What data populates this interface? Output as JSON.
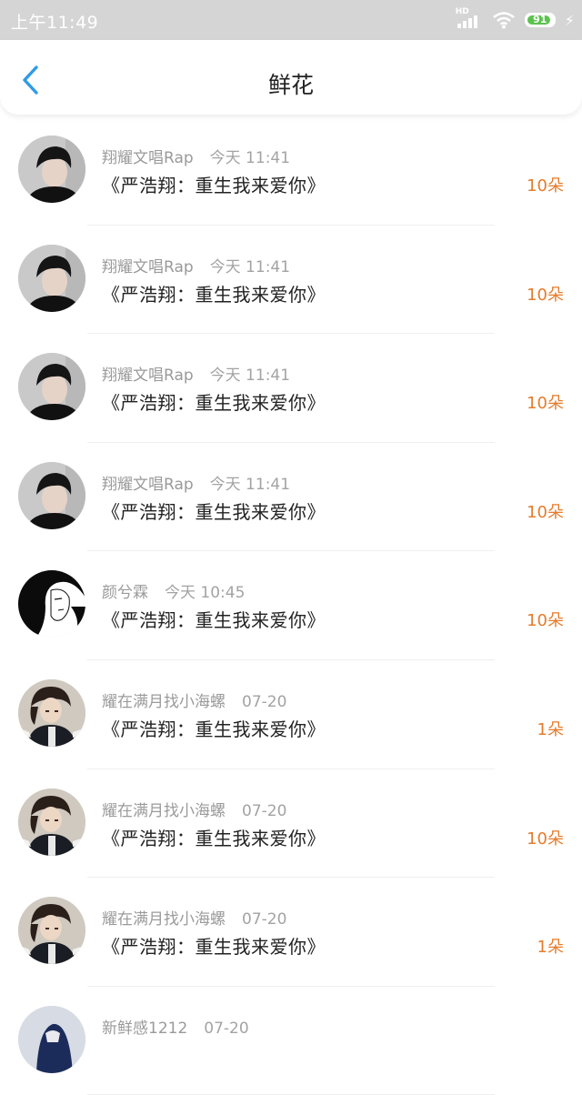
{
  "status_bar": {
    "time": "上午11:49",
    "hd_label": "HD",
    "battery_level": "91",
    "battery_color": "#5cc24e"
  },
  "header": {
    "back_icon": "chevron-left-icon",
    "title": "鲜花",
    "accent_color": "#2e9be8"
  },
  "count_color": "#e57c2c",
  "items": [
    {
      "name": "翔耀文唱Rap",
      "time": "今天 11:41",
      "title": "《严浩翔：重生我来爱你》",
      "count": "10朵",
      "avatar": "boy-photo-avatar"
    },
    {
      "name": "翔耀文唱Rap",
      "time": "今天 11:41",
      "title": "《严浩翔：重生我来爱你》",
      "count": "10朵",
      "avatar": "boy-photo-avatar"
    },
    {
      "name": "翔耀文唱Rap",
      "time": "今天 11:41",
      "title": "《严浩翔：重生我来爱你》",
      "count": "10朵",
      "avatar": "boy-photo-avatar"
    },
    {
      "name": "翔耀文唱Rap",
      "time": "今天 11:41",
      "title": "《严浩翔：重生我来爱你》",
      "count": "10朵",
      "avatar": "boy-photo-avatar"
    },
    {
      "name": "颜兮霖",
      "time": "今天 10:45",
      "title": "《严浩翔：重生我来爱你》",
      "count": "10朵",
      "avatar": "ink-drawing-avatar"
    },
    {
      "name": "耀在满月找小海螺",
      "time": "07-20",
      "title": "《严浩翔：重生我来爱你》",
      "count": "1朵",
      "avatar": "anime-character-avatar"
    },
    {
      "name": "耀在满月找小海螺",
      "time": "07-20",
      "title": "《严浩翔：重生我来爱你》",
      "count": "10朵",
      "avatar": "anime-character-avatar"
    },
    {
      "name": "耀在满月找小海螺",
      "time": "07-20",
      "title": "《严浩翔：重生我来爱你》",
      "count": "1朵",
      "avatar": "anime-character-avatar"
    },
    {
      "name": "新鲜感1212",
      "time": "07-20",
      "title": "",
      "count": "",
      "avatar": "navy-photo-avatar"
    }
  ]
}
